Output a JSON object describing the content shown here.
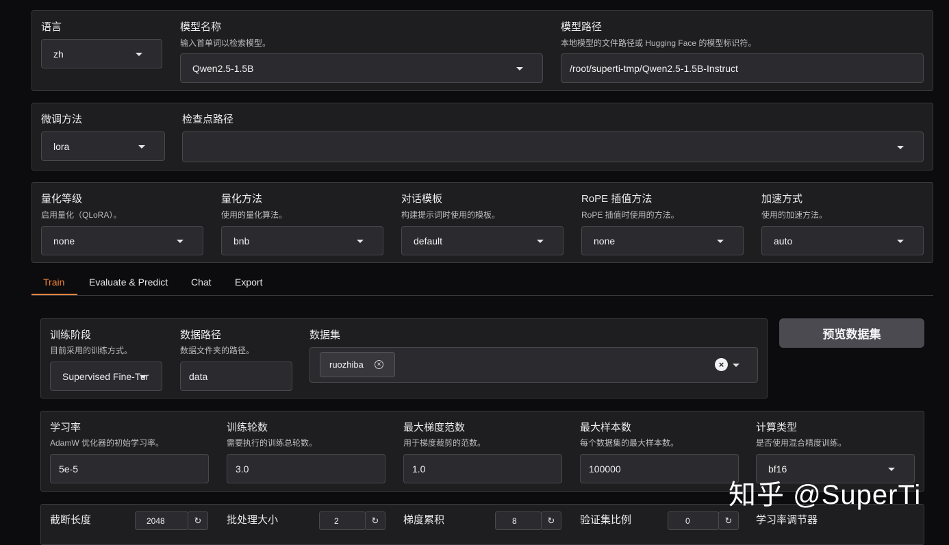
{
  "top": {
    "language": {
      "label": "语言",
      "value": "zh"
    },
    "model_name": {
      "label": "模型名称",
      "desc": "输入首单词以检索模型。",
      "value": "Qwen2.5-1.5B"
    },
    "model_path": {
      "label": "模型路径",
      "desc": "本地模型的文件路径或 Hugging Face 的模型标识符。",
      "value": "/root/superti-tmp/Qwen2.5-1.5B-Instruct"
    }
  },
  "finetune": {
    "method": {
      "label": "微调方法",
      "value": "lora"
    },
    "checkpoint": {
      "label": "检查点路径",
      "value": ""
    }
  },
  "advanced": {
    "quant_bit": {
      "label": "量化等级",
      "desc": "启用量化（QLoRA）。",
      "value": "none"
    },
    "quant_method": {
      "label": "量化方法",
      "desc": "使用的量化算法。",
      "value": "bnb"
    },
    "template": {
      "label": "对话模板",
      "desc": "构建提示词时使用的模板。",
      "value": "default"
    },
    "rope": {
      "label": "RoPE 插值方法",
      "desc": "RoPE 插值时使用的方法。",
      "value": "none"
    },
    "booster": {
      "label": "加速方式",
      "desc": "使用的加速方法。",
      "value": "auto"
    }
  },
  "tabs": [
    "Train",
    "Evaluate & Predict",
    "Chat",
    "Export"
  ],
  "train": {
    "stage": {
      "label": "训练阶段",
      "desc": "目前采用的训练方式。",
      "value": "Supervised Fine-Tur"
    },
    "dataset_dir": {
      "label": "数据路径",
      "desc": "数据文件夹的路径。",
      "value": "data"
    },
    "dataset": {
      "label": "数据集",
      "chip": "ruozhiba"
    },
    "preview_button": "预览数据集",
    "learning_rate": {
      "label": "学习率",
      "desc": "AdamW 优化器的初始学习率。",
      "value": "5e-5"
    },
    "epochs": {
      "label": "训练轮数",
      "desc": "需要执行的训练总轮数。",
      "value": "3.0"
    },
    "max_grad_norm": {
      "label": "最大梯度范数",
      "desc": "用于梯度裁剪的范数。",
      "value": "1.0"
    },
    "max_samples": {
      "label": "最大样本数",
      "desc": "每个数据集的最大样本数。",
      "value": "100000"
    },
    "compute_type": {
      "label": "计算类型",
      "desc": "是否使用混合精度训练。",
      "value": "bf16"
    },
    "cutoff_len": {
      "label": "截断长度",
      "value": "2048"
    },
    "batch_size": {
      "label": "批处理大小",
      "value": "2"
    },
    "grad_accum": {
      "label": "梯度累积",
      "value": "8"
    },
    "val_size": {
      "label": "验证集比例",
      "value": "0"
    },
    "lr_scheduler": {
      "label": "学习率调节器"
    }
  },
  "watermark": "知乎 @SuperTi",
  "icons": {
    "dropdown": "chevron-down-icon",
    "reset": "reset-icon",
    "remove": "close-icon"
  },
  "colors": {
    "accent": "#f0843a",
    "panel": "#1e1e21",
    "background": "#0c0c0e"
  }
}
